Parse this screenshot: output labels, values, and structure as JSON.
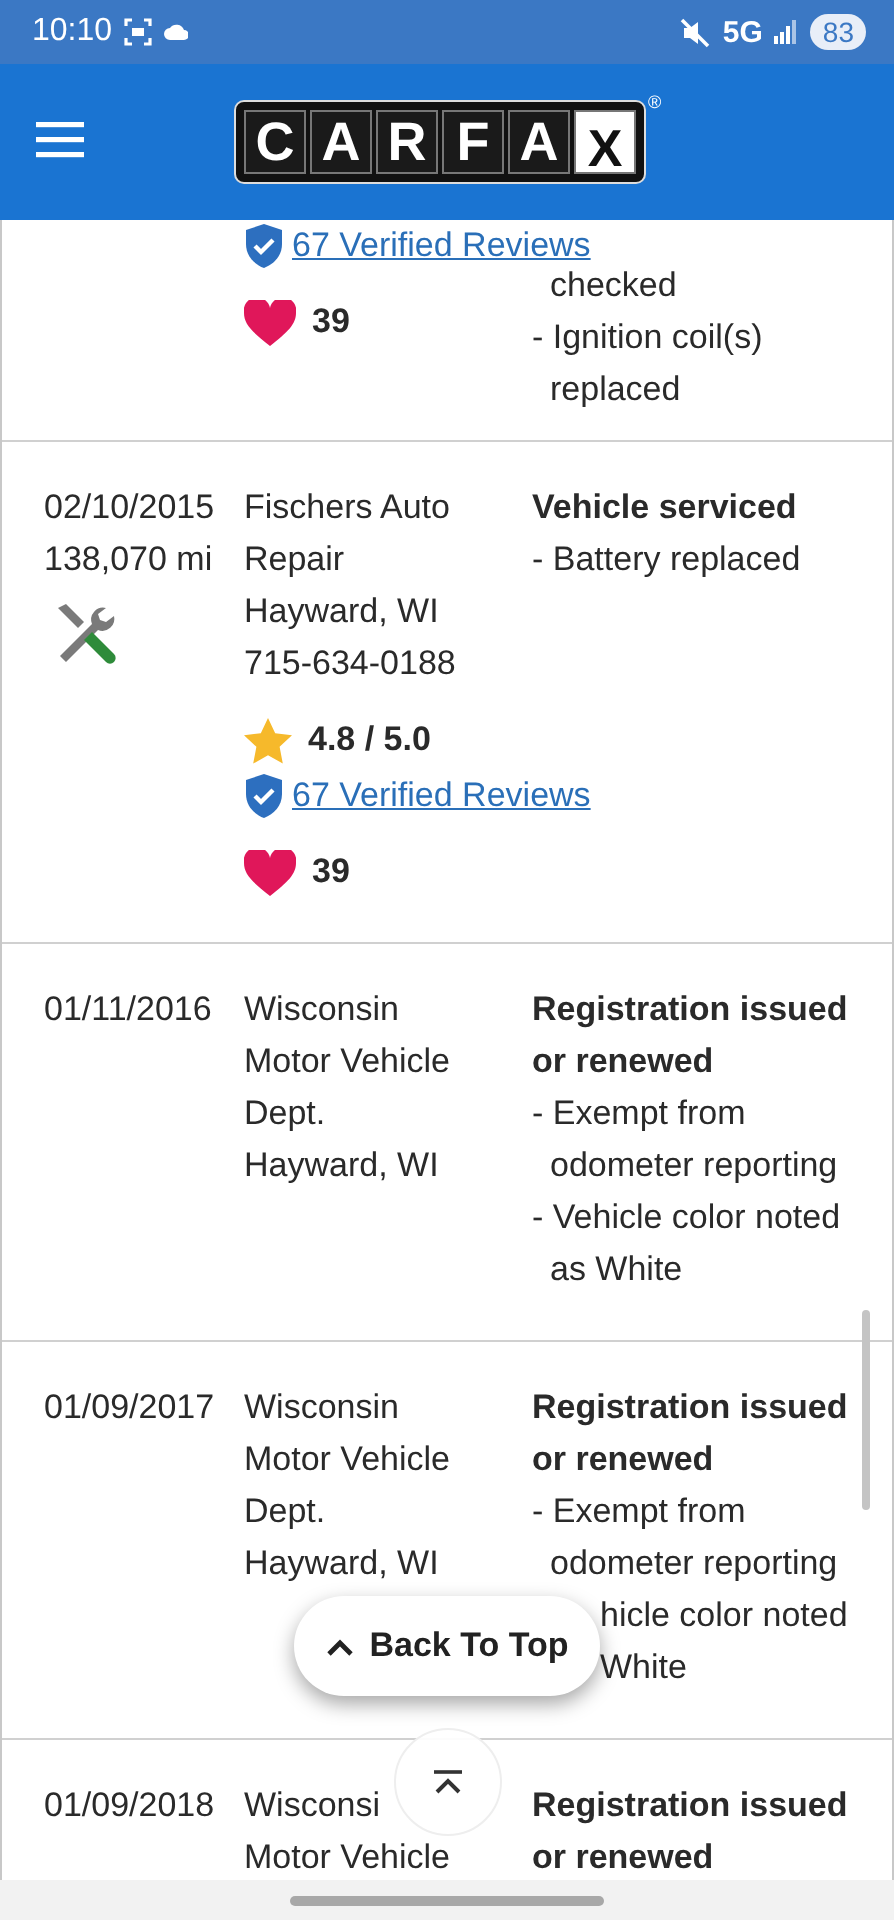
{
  "status_bar": {
    "time": "10:10",
    "network": "5G",
    "battery": "83"
  },
  "header": {
    "logo_letters": [
      "C",
      "A",
      "R",
      "F",
      "A",
      "X"
    ],
    "registered_mark": "®"
  },
  "records": [
    {
      "kind": "continued",
      "reviews": "67 Verified Reviews",
      "favorites": "39",
      "details": [
        {
          "text": "checked",
          "kind": "continued"
        },
        {
          "text": "- Ignition coil(s) replaced",
          "kind": "item"
        }
      ]
    },
    {
      "kind": "service",
      "date": [
        "02/10/2015",
        "138,070 mi"
      ],
      "source": [
        "Fischers Auto Repair",
        "Hayward, WI",
        "715-634-0188"
      ],
      "rating": "4.8 / 5.0",
      "reviews": "67 Verified Reviews",
      "favorites": "39",
      "title": "Vehicle serviced",
      "details": [
        {
          "text": "- Battery replaced",
          "kind": "item"
        }
      ]
    },
    {
      "kind": "registration",
      "date": [
        "01/11/2016"
      ],
      "source": [
        "Wisconsin Motor Vehicle Dept.",
        "Hayward, WI"
      ],
      "title": "Registration issued or renewed",
      "details": [
        {
          "text": "- Exempt from odometer reporting",
          "kind": "item"
        },
        {
          "text": "- Vehicle color noted as White",
          "kind": "item"
        }
      ]
    },
    {
      "kind": "registration",
      "date": [
        "01/09/2017"
      ],
      "source": [
        "Wisconsin Motor Vehicle Dept.",
        "Hayward, WI"
      ],
      "title": "Registration issued or renewed",
      "details": [
        {
          "text": "- Exempt from odometer reporting",
          "kind": "item"
        },
        {
          "text": "hicle color noted",
          "kind": "covered"
        },
        {
          "text": "White",
          "kind": "covered"
        }
      ]
    },
    {
      "kind": "registration",
      "date": [
        "01/09/2018"
      ],
      "source": [
        "Wisconsi",
        "Motor Vehicle"
      ],
      "title": "Registration issued or renewed"
    }
  ],
  "back_to_top": {
    "label": "Back To Top"
  }
}
